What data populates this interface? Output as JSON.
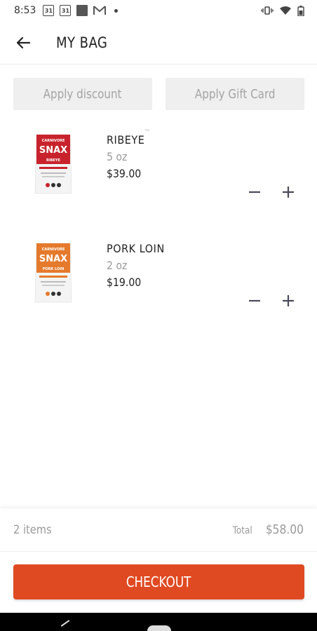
{
  "status_bar": {
    "time": "8:53",
    "calendar_day": "31",
    "icons": [
      "calendar-icon",
      "calendar-icon",
      "photo-icon",
      "gmail-icon",
      "notification-dot-icon",
      "vibrate-icon",
      "wifi-icon",
      "battery-icon"
    ]
  },
  "header": {
    "title": "MY BAG"
  },
  "actions": {
    "discount_label": "Apply discount",
    "gift_card_label": "Apply Gift Card"
  },
  "items": [
    {
      "name": "RIBEYE",
      "size": "5 oz",
      "price": "$39.00",
      "image_color": "#c8232c"
    },
    {
      "name": "PORK LOIN",
      "size": "2 oz",
      "price": "$19.00",
      "image_color": "#e57a2c"
    }
  ],
  "summary": {
    "items_count": "2 items",
    "total_label": "Total",
    "total_value": "$58.00"
  },
  "checkout": {
    "label": "CHECKOUT",
    "color": "#e04a22"
  },
  "product_pack_text": {
    "brand": "SNAX",
    "brand_top": "CARNIVORE"
  }
}
